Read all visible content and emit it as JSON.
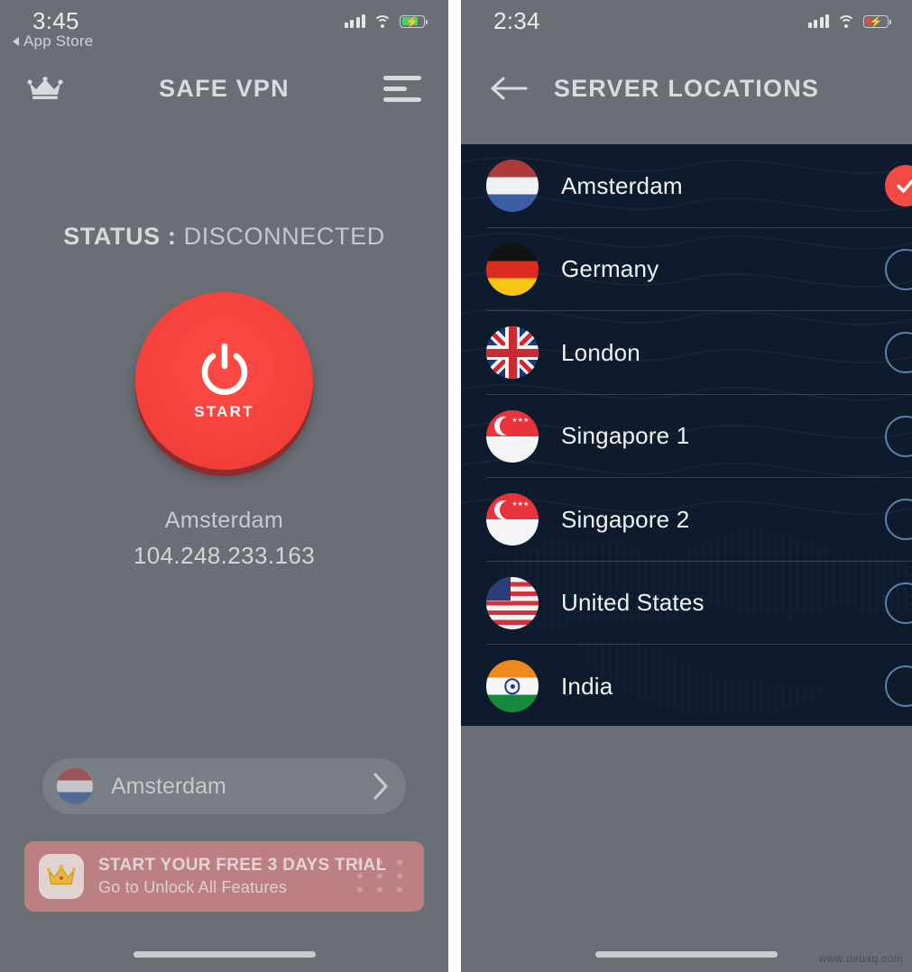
{
  "colors": {
    "screen_bg": "#6a6f76",
    "list_bg": "#0e1b2c",
    "accent_red": "#f6423d",
    "radio_outline": "#5b7fa6",
    "banner_bg": "#bd8082"
  },
  "left_screen": {
    "status_bar": {
      "time": "3:45",
      "back_label": "App Store",
      "signal_icon": "cellular-signal-icon",
      "wifi_icon": "wifi-icon",
      "battery_icon": "battery-charging-icon",
      "battery_state": "charging",
      "battery_color": "#4cd15f"
    },
    "app_bar": {
      "crown_icon": "crown-icon",
      "title": "SAFE VPN",
      "menu_icon": "hamburger-menu-icon"
    },
    "status": {
      "label": "STATUS :",
      "value": "DISCONNECTED"
    },
    "power_button": {
      "icon": "power-icon",
      "label": "START"
    },
    "connection": {
      "server_name": "Amsterdam",
      "ip_address": "104.248.233.163"
    },
    "server_picker": {
      "flag": "nl",
      "label": "Amsterdam",
      "chevron_icon": "chevron-right-icon"
    },
    "trial_banner": {
      "icon": "crown-badge-icon",
      "title": "START YOUR FREE 3 DAYS TRIAL",
      "subtitle": "Go to Unlock All Features"
    }
  },
  "right_screen": {
    "status_bar": {
      "time": "2:34",
      "signal_icon": "cellular-signal-icon",
      "wifi_icon": "wifi-icon",
      "battery_icon": "battery-charging-icon",
      "battery_state": "charging-low",
      "battery_color": "#e04a46"
    },
    "app_bar": {
      "back_icon": "back-arrow-icon",
      "title": "SERVER LOCATIONS"
    },
    "locations": [
      {
        "name": "Amsterdam",
        "flag": "nl",
        "selected": true
      },
      {
        "name": "Germany",
        "flag": "de",
        "selected": false
      },
      {
        "name": "London",
        "flag": "uk",
        "selected": false
      },
      {
        "name": "Singapore 1",
        "flag": "sg",
        "selected": false
      },
      {
        "name": "Singapore 2",
        "flag": "sg",
        "selected": false
      },
      {
        "name": "United States",
        "flag": "us",
        "selected": false
      },
      {
        "name": "India",
        "flag": "in",
        "selected": false
      }
    ]
  },
  "watermark": "www.deuaq.com"
}
